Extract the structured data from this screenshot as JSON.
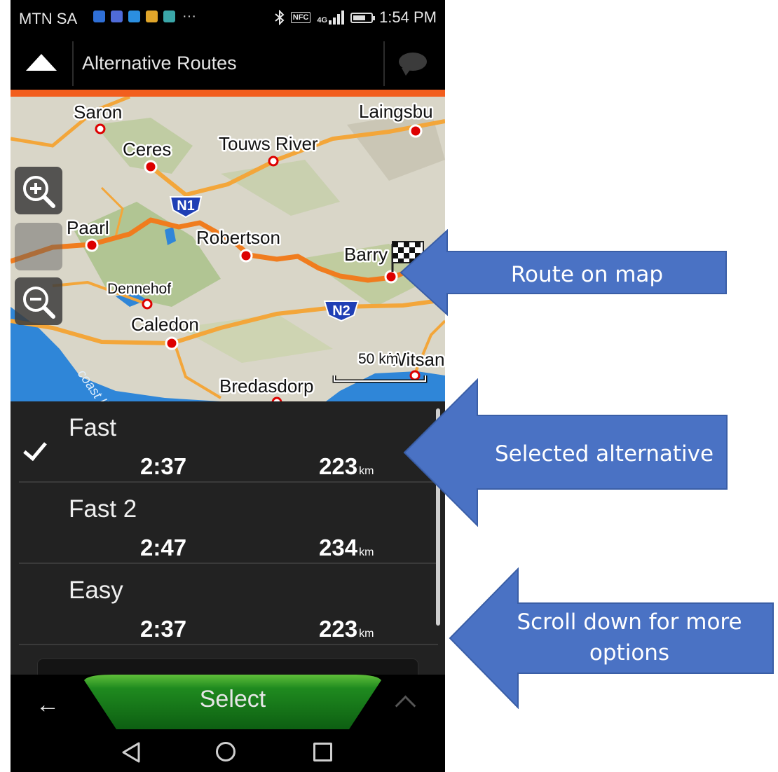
{
  "status_bar": {
    "carrier": "MTN SA",
    "more": "···",
    "nfc": "NFC",
    "network": "4G",
    "battery_level": 0.7,
    "time": "1:54 PM"
  },
  "header": {
    "title": "Alternative Routes"
  },
  "map": {
    "places": [
      "Saron",
      "Laingsbu",
      "Ceres",
      "Touws River",
      "Paarl",
      "Robertson",
      "Barry",
      "Dennehof",
      "Caledon",
      "Witsand",
      "Bredasdorp"
    ],
    "highway_shields": [
      "N1",
      "N2"
    ],
    "coast_label": "coast line",
    "scale": "50 km",
    "colors": {
      "route": "#f07c1e",
      "road": "#f3a63a",
      "sea": "#2f86d8"
    }
  },
  "routes": [
    {
      "name": "Fast",
      "time": "2:37",
      "distance": "223",
      "unit": "km",
      "selected": true
    },
    {
      "name": "Fast 2",
      "time": "2:47",
      "distance": "234",
      "unit": "km",
      "selected": false
    },
    {
      "name": "Easy",
      "time": "2:37",
      "distance": "223",
      "unit": "km",
      "selected": false
    }
  ],
  "bottom_bar": {
    "select_label": "Select"
  },
  "annotations": {
    "route_on_map": "Route on map",
    "selected_alternative": "Selected alternative",
    "scroll_down": "Scroll down for more options",
    "arrow_color": "#4a72c4"
  }
}
